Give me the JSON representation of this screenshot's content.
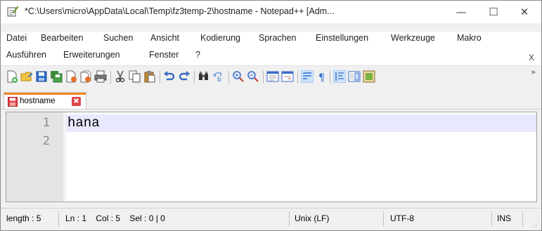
{
  "window": {
    "title": "*C:\\Users\\micro\\AppData\\Local\\Temp\\fz3temp-2\\hostname - Notepad++ [Adm...",
    "app_icon": "notepad-plus-plus-icon",
    "controls": {
      "minimize": "—",
      "maximize": "☐",
      "close": "✕"
    }
  },
  "menubar": {
    "row1": [
      "Datei",
      "Bearbeiten",
      "Suchen",
      "Ansicht",
      "Kodierung",
      "Sprachen",
      "Einstellungen",
      "Werkzeuge",
      "Makro"
    ],
    "row2": [
      "Ausführen",
      "Erweiterungen",
      "Fenster",
      "?"
    ],
    "close_label": "X"
  },
  "toolbar": {
    "icons": [
      "new-file-icon",
      "open-file-icon",
      "save-icon",
      "save-all-icon",
      "close-icon",
      "close-all-icon",
      "print-icon",
      "cut-icon",
      "copy-icon",
      "paste-icon",
      "undo-icon",
      "redo-icon",
      "find-icon",
      "replace-icon",
      "zoom-in-icon",
      "zoom-out-icon",
      "sync-vertical-icon",
      "sync-horizontal-icon",
      "word-wrap-icon",
      "show-all-characters-icon",
      "indent-guide-icon",
      "document-map-icon",
      "function-list-icon"
    ],
    "more_label": "»"
  },
  "tabs": [
    {
      "label": "hostname",
      "close": "✖",
      "icon": "modified-document-icon"
    }
  ],
  "editor": {
    "lines": [
      {
        "number": "1",
        "text": "hana"
      },
      {
        "number": "2",
        "text": ""
      }
    ]
  },
  "status": {
    "length": "length : 5",
    "position": "Ln : 1    Col : 5    Sel : 0 | 0",
    "eol": "Unix (LF)",
    "encoding": "UTF-8",
    "mode": "INS"
  },
  "colors": {
    "tab_accent": "#f28a22",
    "current_line": "#e8e8ff",
    "gutter": "#e4e4e4"
  }
}
